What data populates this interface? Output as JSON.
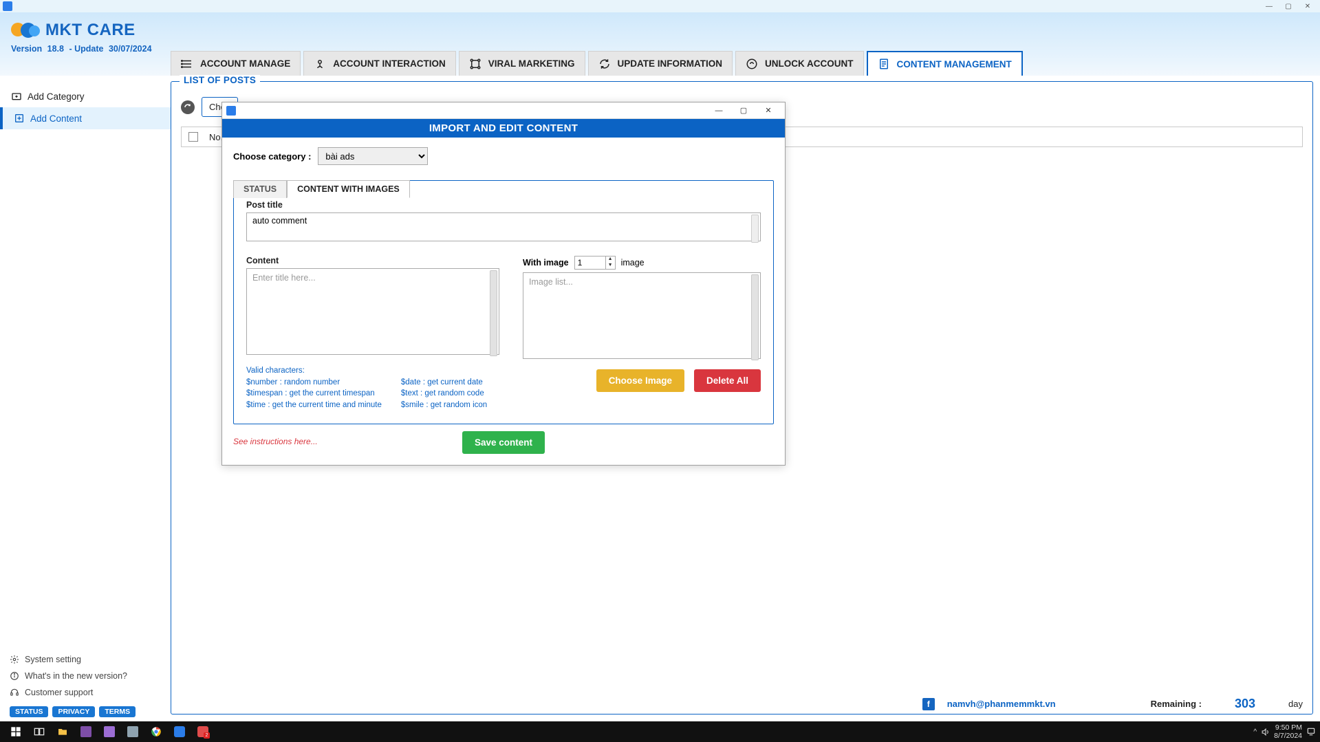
{
  "app": {
    "name": "MKT CARE",
    "version_label": "Version",
    "version": "18.8",
    "update_label": "- Update",
    "update_date": "30/07/2024"
  },
  "main_tabs": [
    {
      "label": "ACCOUNT MANAGE"
    },
    {
      "label": "ACCOUNT INTERACTION"
    },
    {
      "label": "VIRAL MARKETING"
    },
    {
      "label": "UPDATE INFORMATION"
    },
    {
      "label": "UNLOCK ACCOUNT"
    },
    {
      "label": "CONTENT MANAGEMENT"
    }
  ],
  "sidebar": {
    "items": [
      {
        "label": "Add Category"
      },
      {
        "label": "Add Content"
      }
    ],
    "bottom": [
      {
        "label": "System setting"
      },
      {
        "label": "What's in the new version?"
      },
      {
        "label": "Customer support"
      }
    ],
    "badges": [
      "STATUS",
      "PRIVACY",
      "TERMS"
    ]
  },
  "panel": {
    "title": "LIST OF POSTS",
    "choose_prefix": "Choo",
    "table": {
      "col_no": "No."
    }
  },
  "footer": {
    "email": "namvh@phanmemmkt.vn",
    "remaining_label": "Remaining :",
    "remaining_value": "303",
    "remaining_unit": "day"
  },
  "modal": {
    "title": "IMPORT AND EDIT CONTENT",
    "choose_category_label": "Choose category :",
    "category_value": "bài ads",
    "tabs": [
      "STATUS",
      "CONTENT WITH IMAGES"
    ],
    "post_title_label": "Post title",
    "post_title_value": "auto comment",
    "content_label": "Content",
    "content_placeholder": "Enter title here...",
    "with_image_label": "With image",
    "with_image_value": "1",
    "image_unit": "image",
    "image_list_placeholder": "Image list...",
    "hints_header": "Valid characters:",
    "hints_colA": [
      "$number : random number",
      "$timespan : get the current timespan",
      "$time : get the current time and minute"
    ],
    "hints_colB": [
      "$date : get current date",
      "$text : get random code",
      "$smile : get random icon"
    ],
    "choose_image_btn": "Choose Image",
    "delete_all_btn": "Delete All",
    "see_instructions": "See instructions here...",
    "save_btn": "Save content"
  },
  "taskbar": {
    "time": "9:50 PM",
    "date": "8/7/2024"
  }
}
